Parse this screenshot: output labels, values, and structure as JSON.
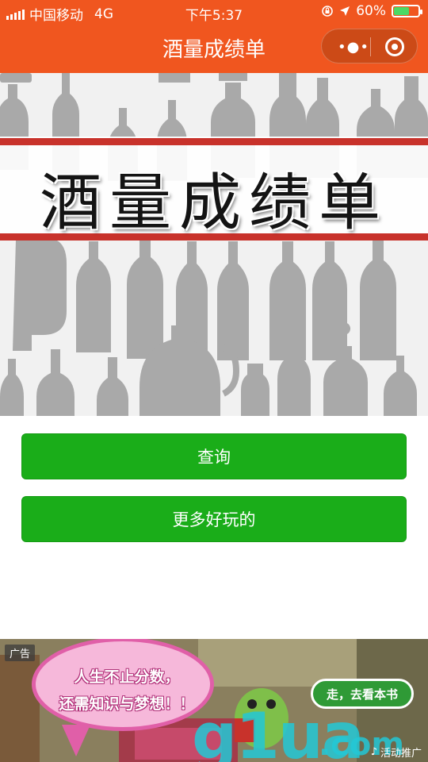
{
  "status_bar": {
    "carrier": "中国移动",
    "network": "4G",
    "time": "下午5:37",
    "battery": "60%",
    "battery_level": 0.6,
    "icons": [
      "signal-icon",
      "lock-rotation-icon",
      "location-arrow-icon",
      "battery-icon"
    ]
  },
  "nav": {
    "title": "酒量成绩单",
    "menu_icon": "more-dots-icon",
    "close_icon": "target-circle-icon"
  },
  "banner": {
    "title": "酒量成绩单",
    "accent_color": "#c8322b",
    "background_motif": "bottle-silhouettes"
  },
  "buttons": {
    "query": "查询",
    "more_fun": "更多好玩的",
    "color": "#1aad19"
  },
  "ad": {
    "label": "广告",
    "bubble_line1": "人生不止分数，",
    "bubble_line2": "还需知识与梦想！！",
    "cta": "走，去看本书",
    "watermark": "g1ua",
    "watermark_suffix": ".com",
    "promo": "活动推广"
  }
}
